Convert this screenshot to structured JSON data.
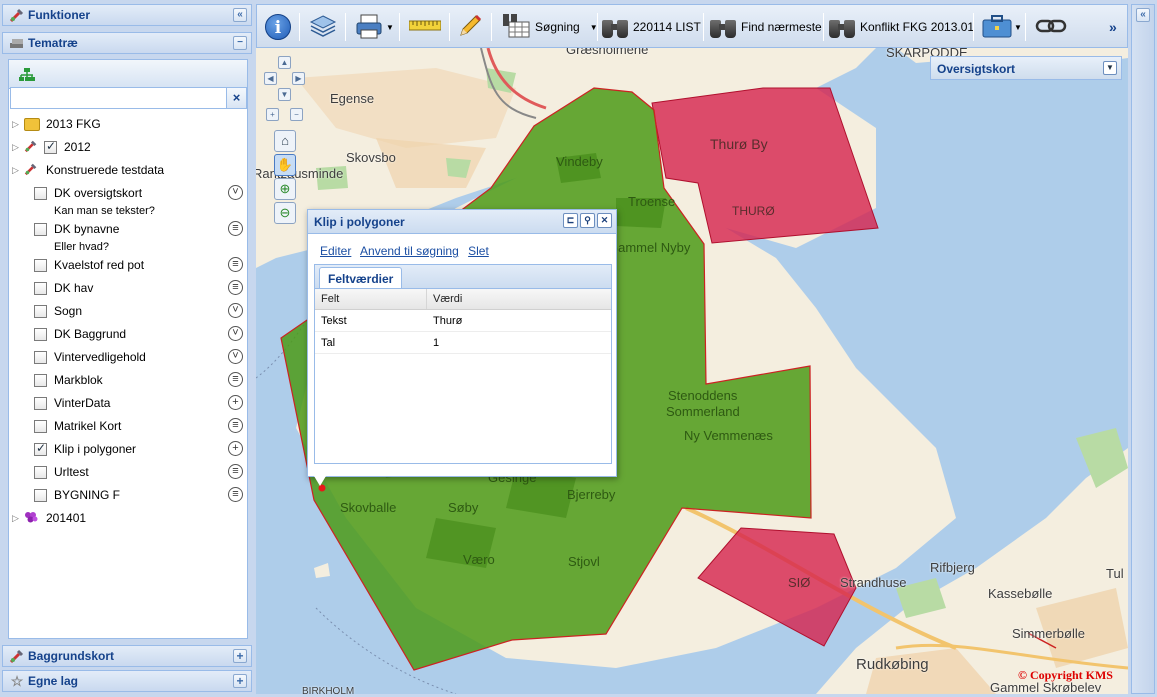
{
  "left_panel": {
    "funktioner": "Funktioner",
    "tematrae": "Tematræ",
    "search_placeholder": "",
    "tree": [
      {
        "label": "2013 FKG",
        "type": "folder"
      },
      {
        "label": "2012",
        "type": "checked-folder"
      },
      {
        "label": "Konstruerede testdata",
        "type": "tool-folder"
      },
      {
        "label": "DK oversigtskort",
        "checked": false,
        "icon": "chevron-down-circle-icon",
        "sub": "Kan man se tekster?"
      },
      {
        "label": "DK bynavne",
        "checked": false,
        "icon": "lines-circle-icon",
        "sub": "Eller hvad?"
      },
      {
        "label": "Kvaelstof red pot",
        "checked": false,
        "icon": "lines-circle-icon"
      },
      {
        "label": "DK hav",
        "checked": false,
        "icon": "lines-circle-icon"
      },
      {
        "label": "Sogn",
        "checked": false,
        "icon": "chevron-down-circle-icon"
      },
      {
        "label": "DK Baggrund",
        "checked": false,
        "icon": "chevron-down-circle-icon"
      },
      {
        "label": "Vintervedligehold",
        "checked": false,
        "icon": "chevron-down-circle-icon"
      },
      {
        "label": "Markblok",
        "checked": false,
        "icon": "lines-circle-icon"
      },
      {
        "label": "VinterData",
        "checked": false,
        "icon": "plus-circle-icon"
      },
      {
        "label": "Matrikel Kort",
        "checked": false,
        "icon": "lines-circle-icon"
      },
      {
        "label": "Klip i polygoner",
        "checked": true,
        "icon": "plus-circle-icon"
      },
      {
        "label": "Urltest",
        "checked": false,
        "icon": "lines-circle-icon"
      },
      {
        "label": "BYGNING F",
        "checked": false,
        "icon": "lines-circle-icon"
      },
      {
        "label": "201401",
        "type": "grape-folder"
      }
    ],
    "baggrundskort": "Baggrundskort",
    "egne_lag": "Egne lag"
  },
  "toolbar": {
    "soegning": "Søgning",
    "list": "220114 LIST",
    "find": "Find nærmeste",
    "konflikt": "Konflikt FKG 2013.01",
    "more": "»"
  },
  "map": {
    "overview_title": "Oversigtskort",
    "copyright": "© Copyright KMS",
    "labels": {
      "egense": "Egense",
      "skovsbo": "Skovsbo",
      "rantzausminde": "Rantzausminde",
      "vindeby": "Vindeby",
      "troense": "Troense",
      "gammel_nyby": "Gammel Nyby",
      "thuro_by": "Thurø By",
      "thuro": "THURØ",
      "stenoddens": "Stenoddens",
      "sommerland": "Sommerland",
      "ny_vemmenaes": "Ny Vemmenæs",
      "gesinge": "Gesinge",
      "skovballe": "Skovballe",
      "soby": "Søby",
      "bjerreby": "Bjerreby",
      "vaaro": "Væro",
      "stjovl": "Stjovl",
      "sio": "SIØ",
      "strandhuse": "Strandhuse",
      "rifbjerg": "Rifbjerg",
      "kassebolle": "Kassebølle",
      "simmerbolle": "Simmerbølle",
      "rudkobing": "Rudkøbing",
      "gammel_skrobelev": "Gammel Skrøbelev",
      "tul": "Tul",
      "graesholmene": "Græsholmene",
      "skarpodde": "SKARPODDE",
      "birkholm": "BIRKHOLM"
    },
    "colors": {
      "land": "#f5efe1",
      "water": "#aecdea",
      "green_poly": "#4c9a18",
      "red_poly": "#d6224c",
      "road": "#f2c46d"
    }
  },
  "popup": {
    "title": "Klip i polygoner",
    "links": [
      "Editer",
      "Anvend til søgning",
      "Slet"
    ],
    "tab": "Feltværdier",
    "columns": [
      "Felt",
      "Værdi"
    ],
    "rows": [
      {
        "felt": "Tekst",
        "vaerdi": "Thurø"
      },
      {
        "felt": "Tal",
        "vaerdi": "1"
      }
    ]
  }
}
